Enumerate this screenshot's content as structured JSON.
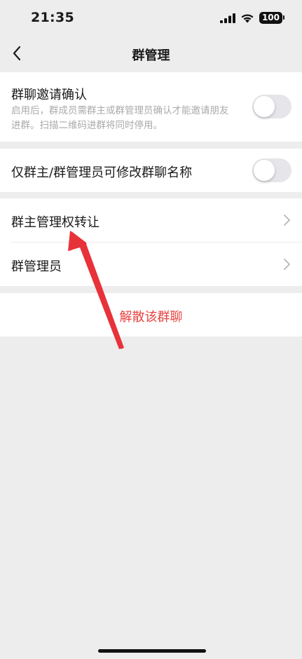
{
  "status_bar": {
    "time": "21:35",
    "battery": "100",
    "icons": [
      "signal-icon",
      "wifi-icon",
      "battery-icon"
    ]
  },
  "nav": {
    "title": "群管理",
    "back_icon": "back-chevron-icon"
  },
  "invite_confirm": {
    "title": "群聊邀请确认",
    "description": "启用后，群成员需群主或群管理员确认才能邀请朋友进群。扫描二维码进群将同时停用。",
    "enabled": false
  },
  "rename_restriction": {
    "title": "仅群主/群管理员可修改群聊名称",
    "enabled": false
  },
  "transfer_owner": {
    "title": "群主管理权转让"
  },
  "admins": {
    "title": "群管理员"
  },
  "dissolve": {
    "label": "解散该群聊"
  },
  "colors": {
    "background": "#ededed",
    "danger": "#e64340",
    "annotation_arrow": "#e8323a",
    "toggle_off": "#e5e5ea"
  }
}
